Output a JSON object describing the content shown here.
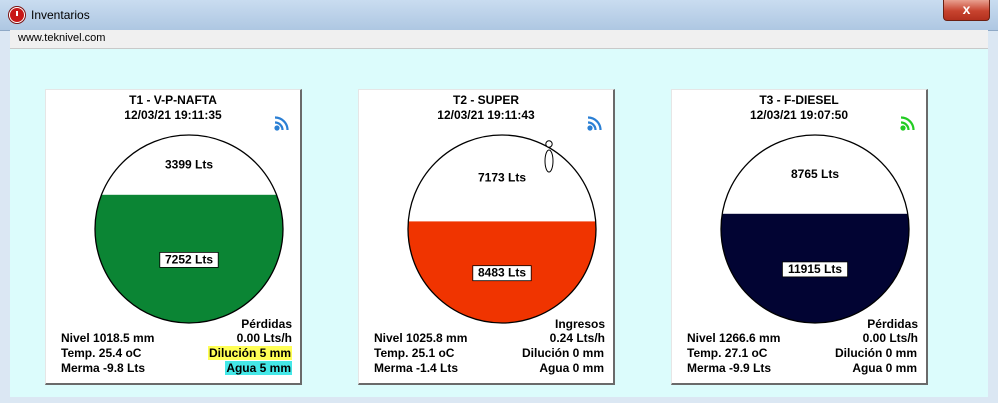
{
  "window": {
    "title": "Inventarios",
    "close_label": "x"
  },
  "menubar": {
    "url": "www.teknivel.com"
  },
  "tanks": [
    {
      "name": "T1 - V-P-NAFTA",
      "timestamp": "12/03/21 19:11:35",
      "signal_icon": "signal-icon",
      "signal_color": "#2a7fd4",
      "fluid_color": "#0b8534",
      "fill_fraction": 0.68,
      "empty_label": "3399 Lts",
      "fluid_label": "7252 Lts",
      "float_marker": false,
      "nivel": "Nivel 1018.5 mm",
      "temp": "Temp. 25.4 oC",
      "merma": "Merma -9.8 Lts",
      "flow_title": "Pérdidas",
      "flow_value": "0.00 Lts/h",
      "dilucion": "Dilución 5 mm",
      "dilucion_bg": "#ffff55",
      "agua": "Agua 5 mm",
      "agua_bg": "#44e8e8"
    },
    {
      "name": "T2 - SUPER",
      "timestamp": "12/03/21 19:11:43",
      "signal_icon": "signal-icon",
      "signal_color": "#2a7fd4",
      "fluid_color": "#f03400",
      "fill_fraction": 0.54,
      "empty_label": "7173 Lts",
      "fluid_label": "8483 Lts",
      "float_marker": true,
      "nivel": "Nivel 1025.8 mm",
      "temp": "Temp. 25.1 oC",
      "merma": "Merma -1.4 Lts",
      "flow_title": "Ingresos",
      "flow_value": "0.24 Lts/h",
      "dilucion": "Dilución 0 mm",
      "dilucion_bg": "",
      "agua": "Agua 0 mm",
      "agua_bg": ""
    },
    {
      "name": "T3 - F-DIESEL",
      "timestamp": "12/03/21 19:07:50",
      "signal_icon": "signal-icon",
      "signal_color": "#22cc22",
      "fluid_color": "#020433",
      "fill_fraction": 0.58,
      "empty_label": "8765 Lts",
      "fluid_label": "11915 Lts",
      "float_marker": false,
      "nivel": "Nivel 1266.6 mm",
      "temp": "Temp. 27.1 oC",
      "merma": "Merma -9.9 Lts",
      "flow_title": "Pérdidas",
      "flow_value": "0.00 Lts/h",
      "dilucion": "Dilución 0 mm",
      "dilucion_bg": "",
      "agua": "Agua 0 mm",
      "agua_bg": ""
    }
  ]
}
